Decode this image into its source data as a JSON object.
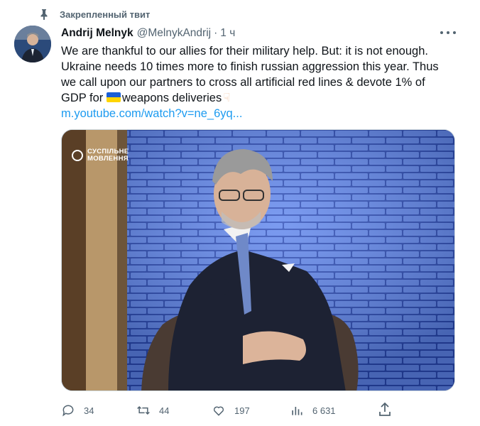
{
  "pinned_label": "Закрепленный твит",
  "author": {
    "name": "Andrij Melnyk",
    "handle": "@MelnykAndrij",
    "separator": "·",
    "time": "1 ч"
  },
  "tweet": {
    "line1": "We are thankful to our allies for their military help. But: it is not enough.",
    "line2": "Ukraine needs 10 times more to finish russian aggression this year. Thus",
    "line3": "we call upon our partners to cross all artificial red lines & devote 1% of",
    "line4_prefix": "GDP for",
    "line4_suffix": "weapons deliveries",
    "link": "m.youtube.com/watch?v=ne_6yq..."
  },
  "media": {
    "brand_line1": "СУСПІЛЬНЕ",
    "brand_line2": "МОВЛЕННЯ"
  },
  "actions": {
    "replies": "34",
    "retweets": "44",
    "likes": "197",
    "views": "6 631"
  },
  "icons": {
    "pin": "pin-icon",
    "more": "more-icon",
    "reply": "reply-icon",
    "retweet": "retweet-icon",
    "like": "heart-icon",
    "views": "views-icon",
    "share": "share-icon",
    "flag": "ukraine-flag-icon",
    "hand": "hand-pointing-down-icon"
  },
  "colors": {
    "link": "#1d9bf0",
    "muted": "#536471",
    "text": "#0f1419",
    "flag_blue": "#1a5fd6",
    "flag_yellow": "#ffd500"
  }
}
